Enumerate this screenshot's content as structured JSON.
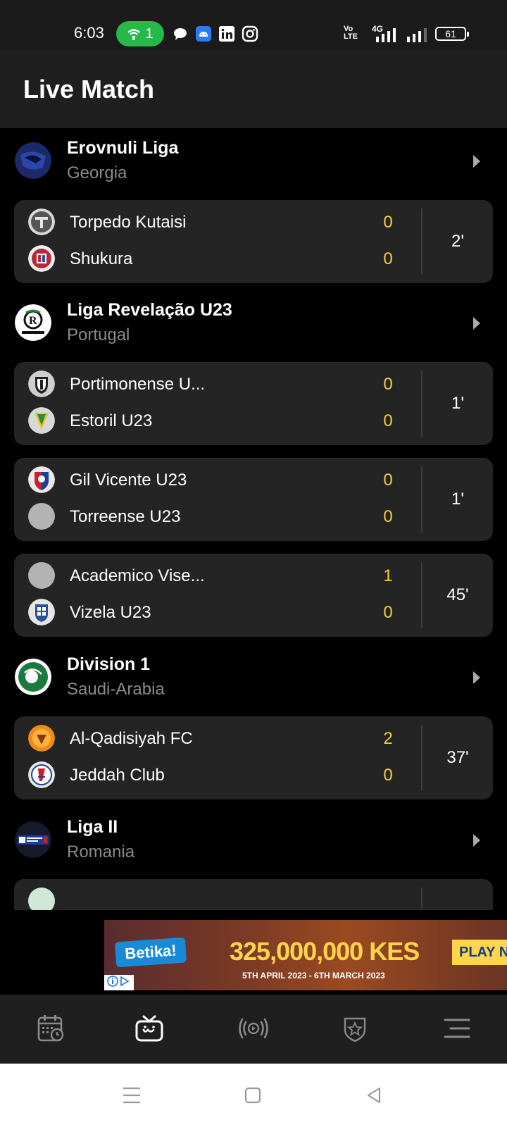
{
  "status_bar": {
    "time": "6:03",
    "hotspot_count": "1",
    "network": "4G",
    "volte": "Vo LTE",
    "battery": "61"
  },
  "header": {
    "title": "Live Match"
  },
  "leagues": [
    {
      "name": "Erovnuli Liga",
      "country": "Georgia",
      "logo_icon": "erovnuli-liga-logo",
      "matches": [
        {
          "home": "Torpedo Kutaisi",
          "away": "Shukura",
          "home_score": "0",
          "away_score": "0",
          "minute": "2'"
        }
      ]
    },
    {
      "name": "Liga Revelação U23",
      "country": "Portugal",
      "logo_icon": "liga-revelacao-logo",
      "matches": [
        {
          "home": "Portimonense U...",
          "away": "Estoril U23",
          "home_score": "0",
          "away_score": "0",
          "minute": "1'"
        },
        {
          "home": "Gil Vicente U23",
          "away": "Torreense U23",
          "home_score": "0",
          "away_score": "0",
          "minute": "1'"
        },
        {
          "home": "Academico Vise...",
          "away": "Vizela U23",
          "home_score": "1",
          "away_score": "0",
          "minute": "45'"
        }
      ]
    },
    {
      "name": "Division 1",
      "country": "Saudi-Arabia",
      "logo_icon": "saff-logo",
      "matches": [
        {
          "home": "Al-Qadisiyah FC",
          "away": "Jeddah Club",
          "home_score": "2",
          "away_score": "0",
          "minute": "37'"
        }
      ]
    },
    {
      "name": "Liga II",
      "country": "Romania",
      "logo_icon": "liga-2-logo",
      "matches": []
    }
  ],
  "ad": {
    "brand": "Betika!",
    "amount": "325,000,000 KES",
    "dates": "5TH APRIL 2023 - 6TH MARCH 2023",
    "cta": "PLAY NOW"
  },
  "bottom_nav": {
    "items": [
      "calendar-icon",
      "live-tv-icon",
      "broadcast-icon",
      "favorites-shield-icon",
      "menu-icon"
    ],
    "active": "live-tv-icon"
  },
  "colors": {
    "score": "#f3cd3a",
    "card_bg": "#242424",
    "header_bg": "#1f1f1f"
  }
}
